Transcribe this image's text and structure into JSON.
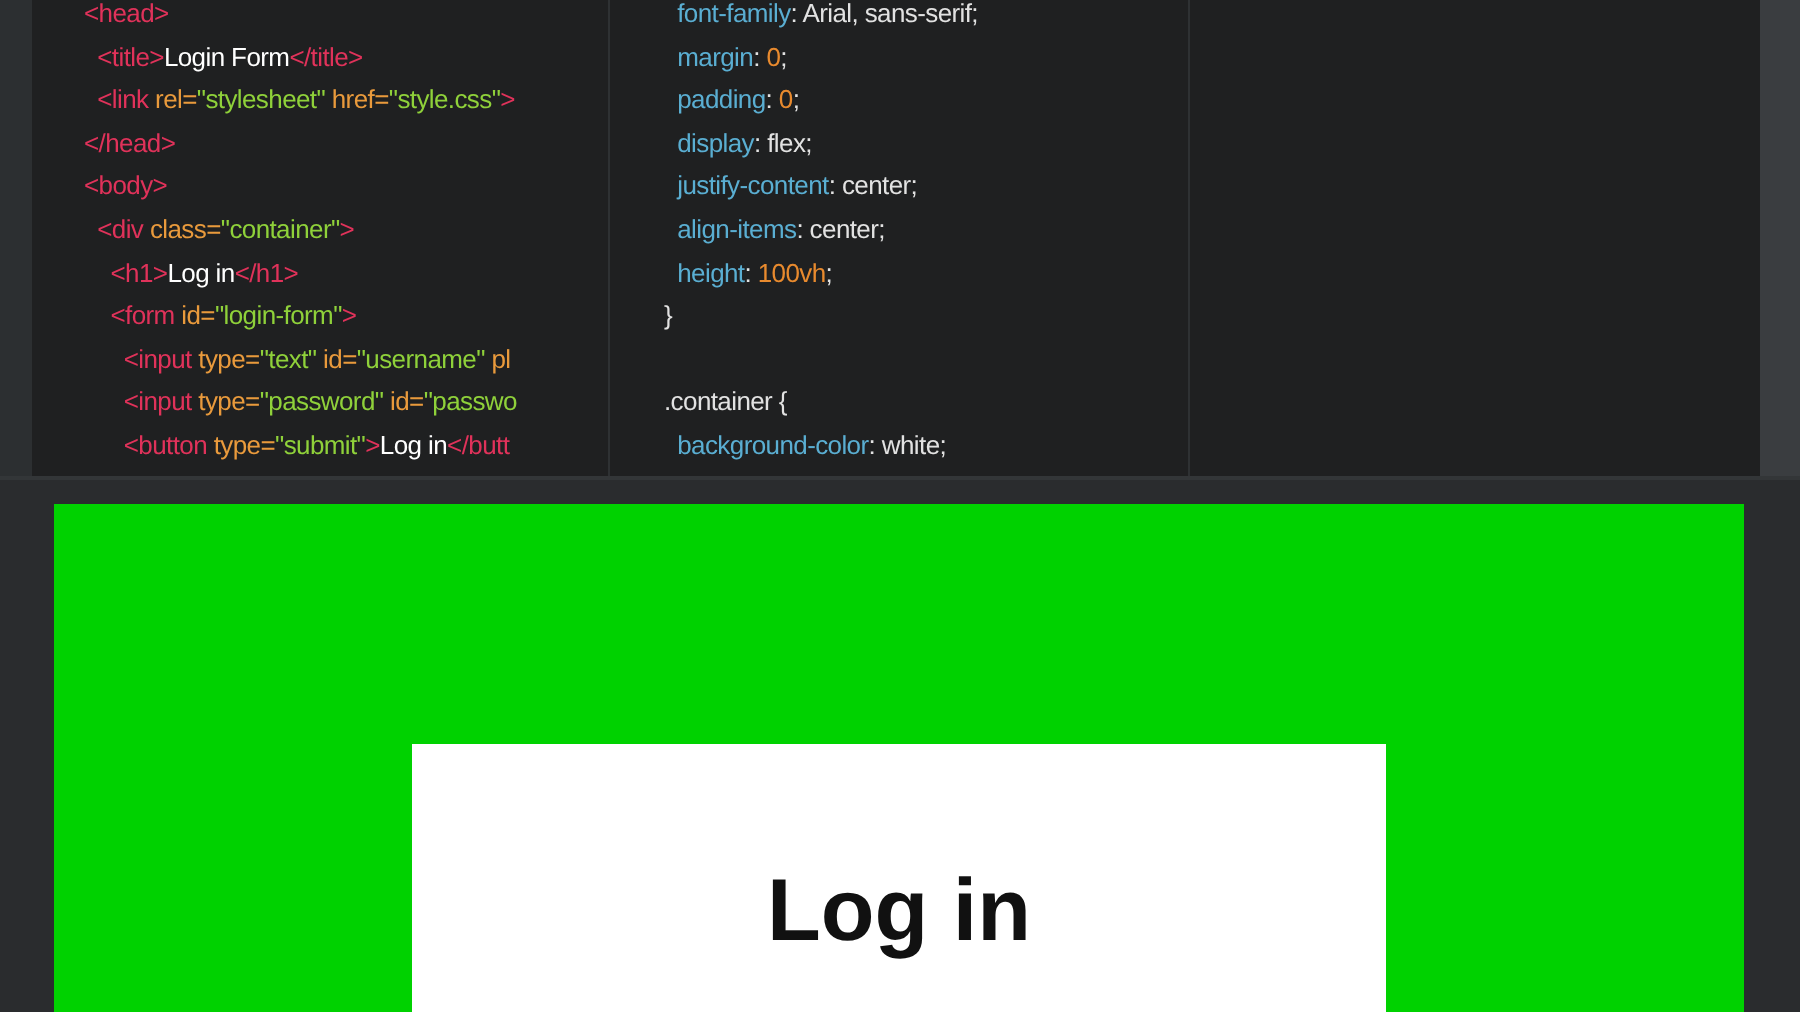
{
  "editor": {
    "html_lines": [
      [
        {
          "kind": "tag",
          "text": "<head>"
        }
      ],
      [
        {
          "kind": "tag",
          "text": "  <title>"
        },
        {
          "kind": "text",
          "text": "Login Form"
        },
        {
          "kind": "tag",
          "text": "</title>"
        }
      ],
      [
        {
          "kind": "tag",
          "text": "  <link"
        },
        {
          "kind": "attr",
          "text": " rel="
        },
        {
          "kind": "str",
          "text": "\"stylesheet\""
        },
        {
          "kind": "attr",
          "text": " href="
        },
        {
          "kind": "str",
          "text": "\"style.css\""
        },
        {
          "kind": "tag",
          "text": ">"
        }
      ],
      [
        {
          "kind": "tag",
          "text": "</head>"
        }
      ],
      [
        {
          "kind": "tag",
          "text": "<body>"
        }
      ],
      [
        {
          "kind": "tag",
          "text": "  <div"
        },
        {
          "kind": "attr",
          "text": " class="
        },
        {
          "kind": "str",
          "text": "\"container\""
        },
        {
          "kind": "tag",
          "text": ">"
        }
      ],
      [
        {
          "kind": "tag",
          "text": "    <h1>"
        },
        {
          "kind": "text",
          "text": "Log in"
        },
        {
          "kind": "tag",
          "text": "</h1>"
        }
      ],
      [
        {
          "kind": "tag",
          "text": "    <form"
        },
        {
          "kind": "attr",
          "text": " id="
        },
        {
          "kind": "str",
          "text": "\"login-form\""
        },
        {
          "kind": "tag",
          "text": ">"
        }
      ],
      [
        {
          "kind": "tag",
          "text": "      <input"
        },
        {
          "kind": "attr",
          "text": " type="
        },
        {
          "kind": "str",
          "text": "\"text\""
        },
        {
          "kind": "attr",
          "text": " id="
        },
        {
          "kind": "str",
          "text": "\"username\""
        },
        {
          "kind": "attr",
          "text": " pl"
        }
      ],
      [
        {
          "kind": "tag",
          "text": "      <input"
        },
        {
          "kind": "attr",
          "text": " type="
        },
        {
          "kind": "str",
          "text": "\"password\""
        },
        {
          "kind": "attr",
          "text": " id="
        },
        {
          "kind": "str",
          "text": "\"passwo"
        }
      ],
      [
        {
          "kind": "tag",
          "text": "      <button"
        },
        {
          "kind": "attr",
          "text": " type="
        },
        {
          "kind": "str",
          "text": "\"submit\""
        },
        {
          "kind": "tag",
          "text": ">"
        },
        {
          "kind": "text",
          "text": "Log in"
        },
        {
          "kind": "tag",
          "text": "</butt"
        }
      ]
    ],
    "css_lines": [
      [
        {
          "kind": "prop",
          "text": "  font-family"
        },
        {
          "kind": "val",
          "text": ": Arial, sans-serif;"
        }
      ],
      [
        {
          "kind": "prop",
          "text": "  margin"
        },
        {
          "kind": "val",
          "text": ": "
        },
        {
          "kind": "num",
          "text": "0"
        },
        {
          "kind": "val",
          "text": ";"
        }
      ],
      [
        {
          "kind": "prop",
          "text": "  padding"
        },
        {
          "kind": "val",
          "text": ": "
        },
        {
          "kind": "num",
          "text": "0"
        },
        {
          "kind": "val",
          "text": ";"
        }
      ],
      [
        {
          "kind": "prop",
          "text": "  display"
        },
        {
          "kind": "val",
          "text": ": flex;"
        }
      ],
      [
        {
          "kind": "prop",
          "text": "  justify-content"
        },
        {
          "kind": "val",
          "text": ": center;"
        }
      ],
      [
        {
          "kind": "prop",
          "text": "  align-items"
        },
        {
          "kind": "val",
          "text": ": center;"
        }
      ],
      [
        {
          "kind": "prop",
          "text": "  height"
        },
        {
          "kind": "val",
          "text": ": "
        },
        {
          "kind": "num",
          "text": "100vh"
        },
        {
          "kind": "val",
          "text": ";"
        }
      ],
      [
        {
          "kind": "val",
          "text": "}"
        }
      ],
      {
        "gap_before": true,
        "tokens": [
          {
            "kind": "val",
            "text": ".container {"
          }
        ]
      },
      [
        {
          "kind": "prop",
          "text": "  background-color"
        },
        {
          "kind": "val",
          "text": ": white;"
        }
      ]
    ]
  },
  "preview": {
    "heading": "Log in"
  }
}
